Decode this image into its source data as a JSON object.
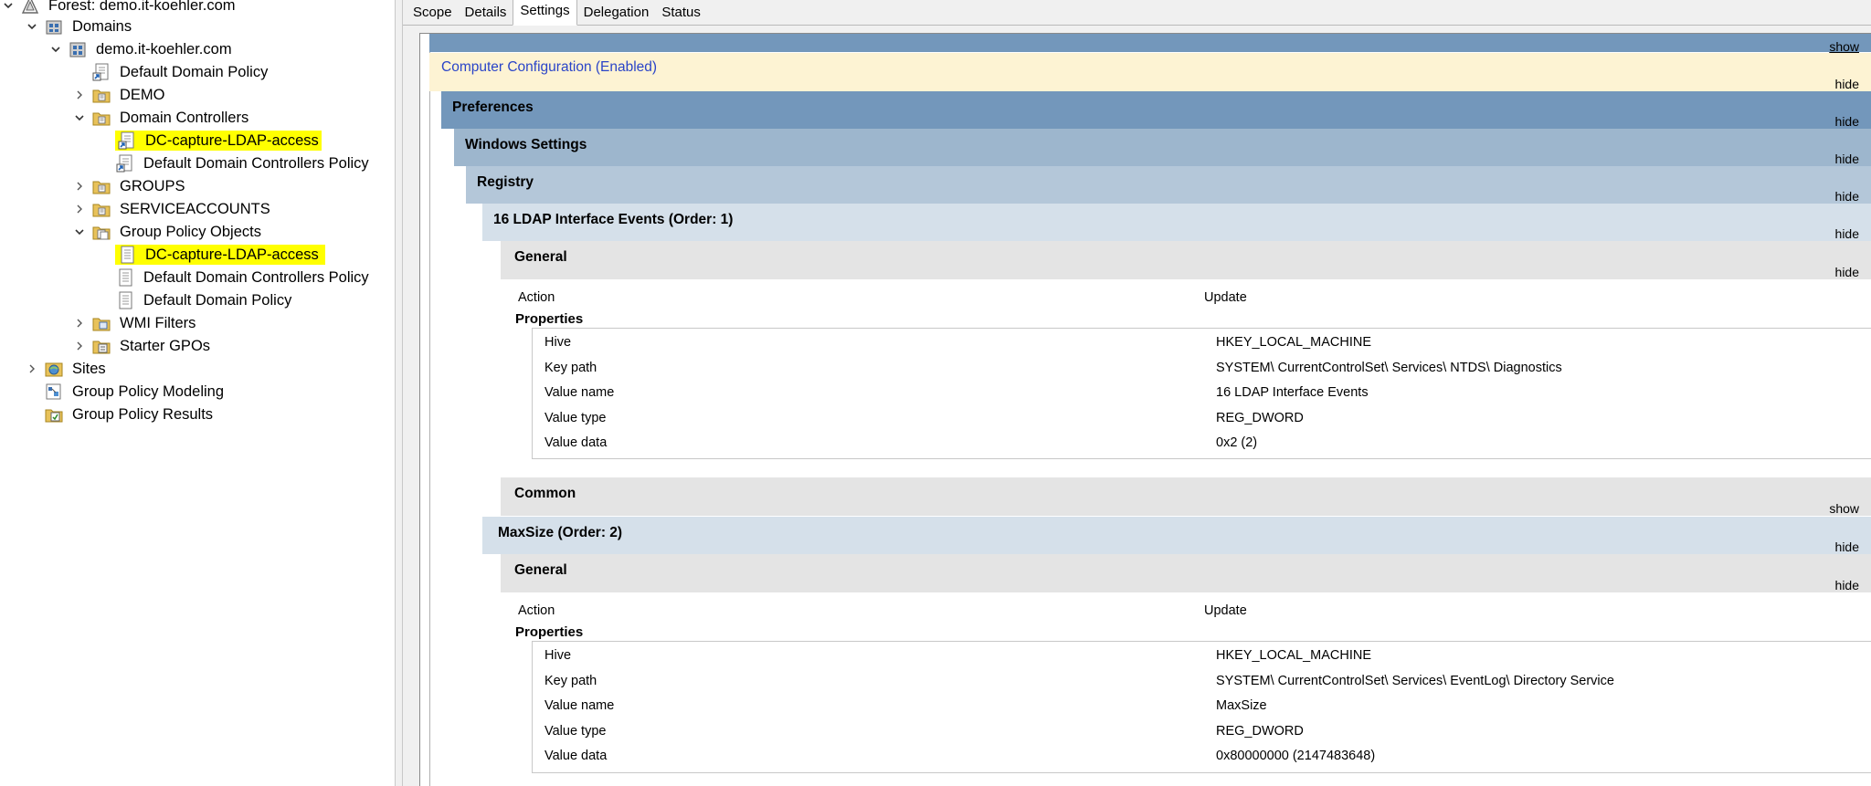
{
  "tree": {
    "forest": "Forest: demo.it-koehler.com",
    "domains": "Domains",
    "domain": "demo.it-koehler.com",
    "default_domain_policy": "Default Domain Policy",
    "demo": "DEMO",
    "domain_controllers": "Domain Controllers",
    "dc_capture_link": "DC-capture-LDAP-access",
    "default_dc_policy_link": "Default Domain Controllers Policy",
    "groups": "GROUPS",
    "serviceaccounts": "SERVICEACCOUNTS",
    "gpo_container": "Group Policy Objects",
    "gpo_dc_capture": "DC-capture-LDAP-access",
    "gpo_default_dc_policy": "Default Domain Controllers Policy",
    "gpo_default_domain_policy": "Default Domain Policy",
    "wmi_filters": "WMI Filters",
    "starter_gpos": "Starter GPOs",
    "sites": "Sites",
    "gp_modeling": "Group Policy Modeling",
    "gp_results": "Group Policy Results"
  },
  "tabs": [
    "Scope",
    "Details",
    "Settings",
    "Delegation",
    "Status"
  ],
  "active_tab": "Settings",
  "report": {
    "top_action": "show",
    "computer_config": "Computer Configuration (Enabled)",
    "computer_config_action": "hide",
    "preferences": "Preferences",
    "preferences_action": "hide",
    "windows_settings": "Windows Settings",
    "windows_settings_action": "hide",
    "registry": "Registry",
    "registry_action": "hide",
    "item1": {
      "title": "16 LDAP Interface Events (Order: 1)",
      "title_action": "hide",
      "general": "General",
      "general_action": "hide",
      "action_label": "Action",
      "action_value": "Update",
      "properties": "Properties",
      "rows": [
        {
          "label": "Hive",
          "value": "HKEY_LOCAL_MACHINE"
        },
        {
          "label": "Key path",
          "value": "SYSTEM\\ CurrentControlSet\\ Services\\ NTDS\\ Diagnostics"
        },
        {
          "label": "Value name",
          "value": "16 LDAP Interface Events"
        },
        {
          "label": "Value type",
          "value": "REG_DWORD"
        },
        {
          "label": "Value data",
          "value": "0x2 (2)"
        }
      ],
      "common": "Common",
      "common_action": "show"
    },
    "item2": {
      "title": "MaxSize (Order: 2)",
      "title_action": "hide",
      "general": "General",
      "general_action": "hide",
      "action_label": "Action",
      "action_value": "Update",
      "properties": "Properties",
      "rows": [
        {
          "label": "Hive",
          "value": "HKEY_LOCAL_MACHINE"
        },
        {
          "label": "Key path",
          "value": "SYSTEM\\ CurrentControlSet\\ Services\\ EventLog\\ Directory Service"
        },
        {
          "label": "Value name",
          "value": "MaxSize"
        },
        {
          "label": "Value type",
          "value": "REG_DWORD"
        },
        {
          "label": "Value data",
          "value": "0x80000000 (2147483648)"
        }
      ]
    }
  },
  "colors": {
    "highlight": "#ffff00",
    "computer_config_bg": "#fdf3d3",
    "computer_config_text": "#2a44c8",
    "preferences_bg": "#7397bb",
    "windows_settings_bg": "#9db6cd",
    "registry_bg": "#b4c7d9",
    "item_bg": "#d5e0ea",
    "general_bg": "#e4e4e4"
  }
}
